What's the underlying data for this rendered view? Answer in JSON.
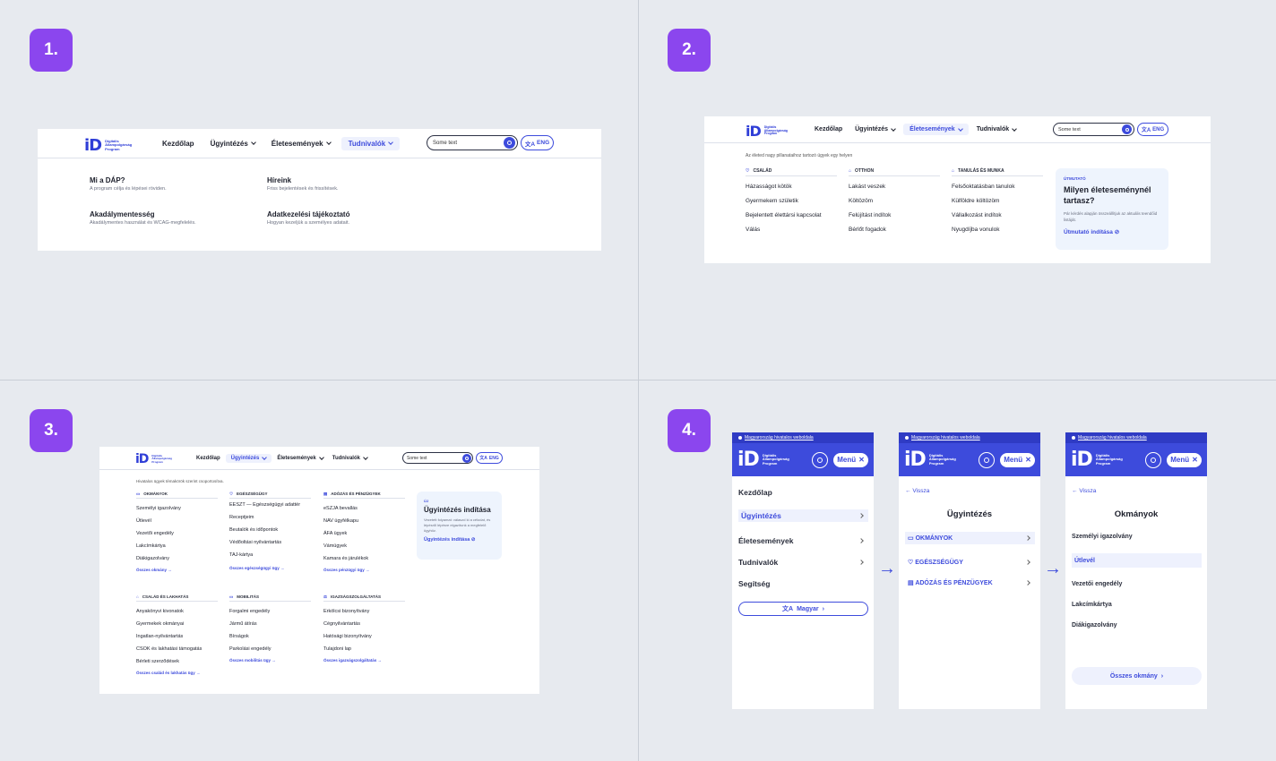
{
  "steps": [
    "1.",
    "2.",
    "3.",
    "4."
  ],
  "brand": {
    "id": "iD",
    "line1": "Digitális",
    "line2": "Állampolgárság",
    "line3": "Program"
  },
  "nav": {
    "home": "Kezdőlap",
    "ugy": "Ügyintézés",
    "elet": "Életesemények",
    "tud": "Tudnivalók"
  },
  "search": {
    "value": "Some text"
  },
  "lang": "ENG",
  "p1": {
    "items": [
      {
        "title": "Mi a DÁP?",
        "desc": "A program célja és lépései röviden."
      },
      {
        "title": "Híreink",
        "desc": "Friss bejelentések és frissítések."
      },
      {
        "title": "Akadálymentesség",
        "desc": "Akadálymentes használat és WCAG-megfelelés."
      },
      {
        "title": "Adatkezelési tájékoztató",
        "desc": "Hogyan kezeljük a személyes adatait."
      }
    ]
  },
  "p2": {
    "intro": "Az életed nagy pillanataihoz tartozó ügyek egy helyen",
    "cols": [
      {
        "head": "CSALÁD",
        "icon": "heart-icon",
        "items": [
          "Házasságot kötök",
          "Gyermekem születik",
          "Bejelentett élettársi kapcsolat",
          "Válás"
        ]
      },
      {
        "head": "OTTHON",
        "icon": "home-icon",
        "items": [
          "Lakást veszek",
          "Költözöm",
          "Felújítást indítok",
          "Bérlőt fogadok"
        ]
      },
      {
        "head": "TANULÁS ÉS MUNKA",
        "icon": "graduation-cap-icon",
        "items": [
          "Felsőoktatásban tanulok",
          "Külföldre költözöm",
          "Vállalkozást indítok",
          "Nyugdíjba vonulok"
        ]
      }
    ],
    "card": {
      "tag": "ÚTMUTATÓ",
      "title": "Milyen életeseménynél tartasz?",
      "desc": "Pár kérdés alapján összeállítjuk az aktuális teendőid listáját.",
      "link": "Útmutató indítása"
    }
  },
  "p3": {
    "intro": "Hivatalos ügyek témakörök szerint csoportosítva.",
    "groups": [
      {
        "head": "OKMÁNYOK",
        "icon": "id-card-icon",
        "items": [
          "Személyi igazolvány",
          "Útlevél",
          "Vezetői engedély",
          "Lakcímkártya",
          "Diákigazolvány"
        ],
        "all": "Összes okmány"
      },
      {
        "head": "EGÉSZSÉGÜGY",
        "icon": "health-icon",
        "items": [
          "EESZT — Egészségügyi adattér",
          "Receptjeim",
          "Beutalók és időpontok",
          "Védőoltási nyilvántartás",
          "TAJ-kártya"
        ],
        "all": "Összes egészségügyi ügy"
      },
      {
        "head": "ADÓZÁS ÉS PÉNZÜGYEK",
        "icon": "calculator-icon",
        "items": [
          "eSZJA bevallás",
          "NAV ügyfélkapu",
          "ÁFA ügyek",
          "Vámügyek",
          "Kamara és járulékok"
        ],
        "all": "Összes pénzügyi ügy"
      },
      {
        "head": "CSALÁD ÉS LAKHATÁS",
        "icon": "home-icon",
        "items": [
          "Anyakönyvi kivonatok",
          "Gyermekek okmányai",
          "Ingatlan-nyilvántartás",
          "CSOK és lakhatási támogatás",
          "Bérleti szerződések"
        ],
        "all": "Összes család és lakhatás ügy"
      },
      {
        "head": "MOBILITÁS",
        "icon": "car-icon",
        "items": [
          "Forgalmi engedély",
          "Jármű átírás",
          "Bírságok",
          "Parkolási engedély"
        ],
        "all": "Összes mobilitás ügy"
      },
      {
        "head": "IGAZSÁGSZOLGÁLTATÁS",
        "icon": "scales-icon",
        "items": [
          "Erkölcsi bizonyítvány",
          "Cégnyilvántartás",
          "Hatósági bizonyítvány",
          "Tulajdoni lap"
        ],
        "all": "Összes igazságszolgáltatás"
      }
    ],
    "card": {
      "tag": "ÚJ",
      "title": "Ügyintézés indítása",
      "desc": "Vezetett folyamat: válaszd ki a célodat, és lépésről lépésre elgazítunk a megfelelő ügyhöz.",
      "link": "Ügyintézés indítása"
    }
  },
  "p4": {
    "topbar": "Magyarország hivatalos weboldala",
    "menu": "Menü",
    "back": "Vissza",
    "m1": {
      "items": [
        "Kezdőlap",
        "Ügyintézés",
        "Életesemények",
        "Tudnivalók",
        "Segítség"
      ],
      "lang": "Magyar"
    },
    "m2": {
      "title": "Ügyintézés",
      "items": [
        "OKMÁNYOK",
        "EGÉSZSÉGÜGY",
        "ADÓZÁS ÉS PÉNZÜGYEK"
      ]
    },
    "m3": {
      "title": "Okmányok",
      "items": [
        "Személyi igazolvány",
        "Útlevél",
        "Vezetői engedély",
        "Lakcímkártya",
        "Diákigazolvány"
      ],
      "all": "Összes okmány"
    }
  }
}
